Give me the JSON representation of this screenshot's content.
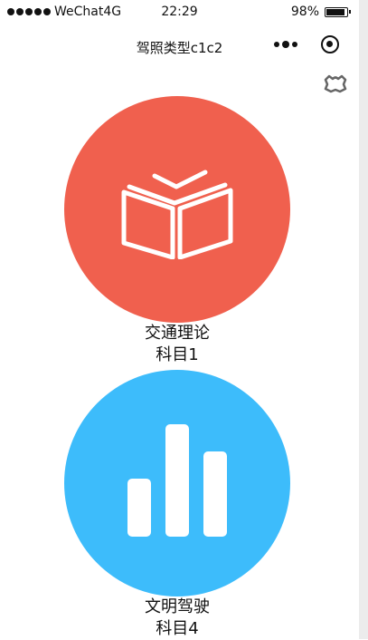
{
  "status_bar": {
    "carrier": "WeChat4G",
    "time": "22:29",
    "battery": "98%"
  },
  "navbar": {
    "title": "驾照类型c1c2"
  },
  "cards": [
    {
      "title": "交通理论",
      "subtitle": "科目1",
      "color": "#f0604e",
      "icon": "open-book-icon"
    },
    {
      "title": "文明驾驶",
      "subtitle": "科目4",
      "color": "#3dbcfb",
      "icon": "bar-chart-icon"
    }
  ]
}
